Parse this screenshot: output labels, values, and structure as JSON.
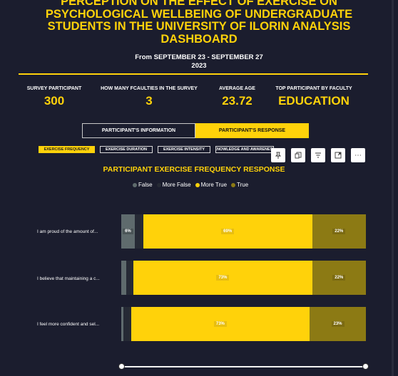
{
  "header": {
    "title_lines": [
      "PERCEPTION ON THE EFFECT OF EXERCISE ON",
      "PSYCHOLOGICAL WELLBEING OF UNDERGRADUATE",
      "STUDENTS IN THE UNIVERSITY OF ILORIN ANALYSIS",
      "DASHBOARD"
    ],
    "date_range": "From SEPTEMBER 23 - SEPTEMBER 27",
    "year": "2023"
  },
  "kpis": [
    {
      "label": "SURVEY PARTICIPANT",
      "value": "300"
    },
    {
      "label": "HOW MANY FCAULTIES IN THE SURVEY",
      "value": "3"
    },
    {
      "label": "AVERAGE AGE",
      "value": "23.72"
    },
    {
      "label": "TOP PARTICIPANT BY FACULTY",
      "value": "EDUCATION"
    }
  ],
  "page_toggle": {
    "info_label": "PARTICIPANT'S INFORMATION",
    "response_label": "PARTICIPANT'S RESPONSE"
  },
  "category_tabs": [
    "EXERCISE FREQUENCY",
    "EXERCISE DURATION",
    "EXERCISE INTENSITY",
    "KNOWLEDGE AND AWARENESS"
  ],
  "visual_toolbar": {
    "more_label": "⋯"
  },
  "colors": {
    "False": "#5f6b6d",
    "More False": "#262a35",
    "More True": "#ffd20a",
    "True": "#8c7a14"
  },
  "chart_data": {
    "type": "bar",
    "orientation": "horizontal-100%-stacked",
    "title": "PARTICIPANT EXERCISE FREQUENCY RESPONSE",
    "legend_position": "top",
    "categories": [
      "I am proud of the amount of...",
      "I believe that maintaining a c...",
      "I feel more confident and sel..."
    ],
    "series": [
      {
        "name": "False",
        "values": [
          5.5,
          2,
          1
        ]
      },
      {
        "name": "More False",
        "values": [
          3.5,
          3,
          3
        ]
      },
      {
        "name": "More True",
        "values": [
          69,
          73,
          73
        ]
      },
      {
        "name": "True",
        "values": [
          22,
          22,
          23
        ]
      }
    ],
    "data_labels": [
      [
        "6%",
        "",
        "69%",
        "22%"
      ],
      [
        "",
        "",
        "73%",
        "22%"
      ],
      [
        "",
        "",
        "73%",
        "23%"
      ]
    ]
  }
}
